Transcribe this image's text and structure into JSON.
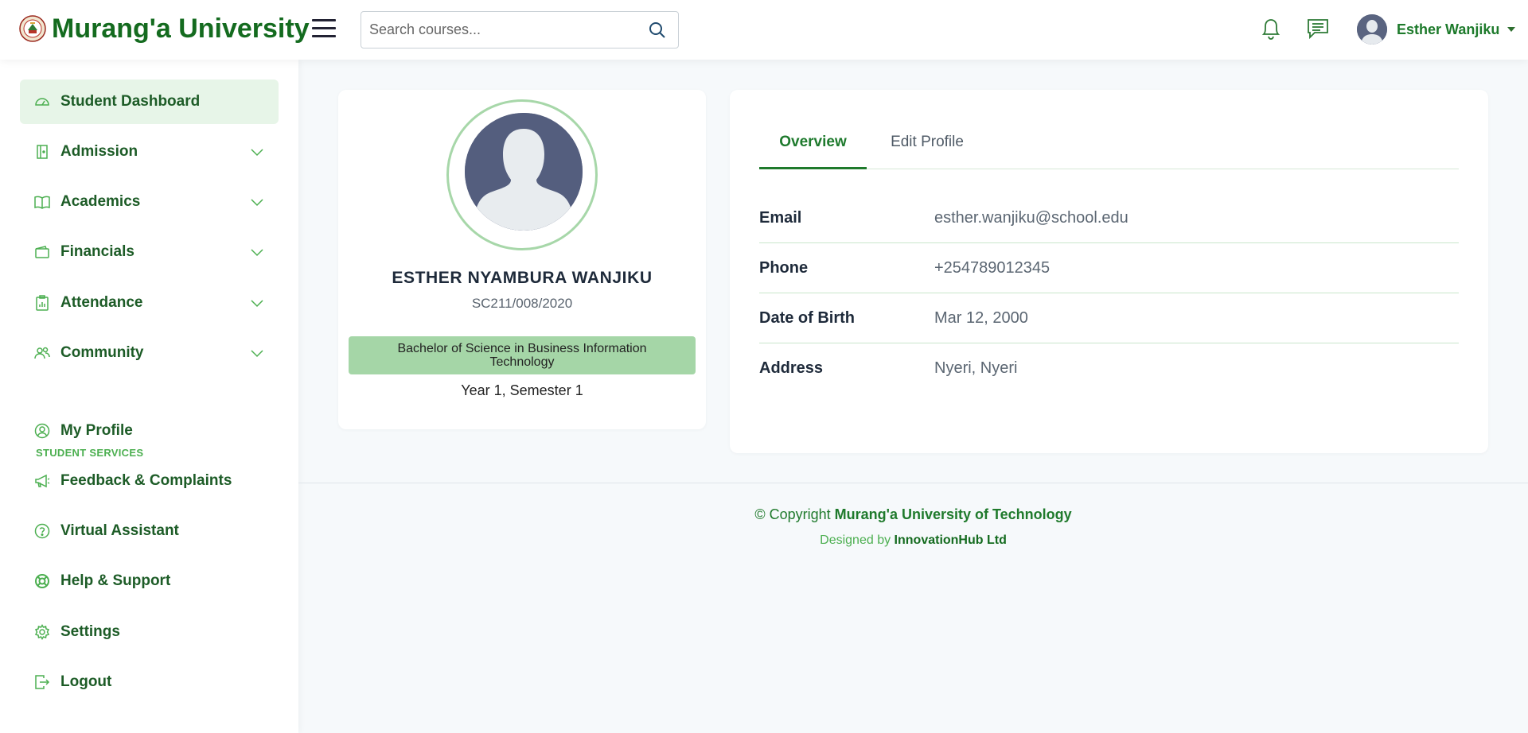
{
  "header": {
    "brand": "Murang'a University",
    "search_placeholder": "Search courses...",
    "user_name": "Esther Wanjiku"
  },
  "sidebar": {
    "items": [
      {
        "label": "Student Dashboard",
        "icon": "gauge-icon"
      },
      {
        "label": "Admission",
        "icon": "door-icon"
      },
      {
        "label": "Academics",
        "icon": "book-icon"
      },
      {
        "label": "Financials",
        "icon": "wallet-icon"
      },
      {
        "label": "Attendance",
        "icon": "clipboard-icon"
      },
      {
        "label": "Community",
        "icon": "people-icon"
      }
    ],
    "section_label": "STUDENT SERVICES",
    "services": [
      {
        "label": "My Profile",
        "icon": "user-circle-icon"
      },
      {
        "label": "Feedback & Complaints",
        "icon": "megaphone-icon"
      },
      {
        "label": "Virtual Assistant",
        "icon": "question-circle-icon"
      },
      {
        "label": "Help & Support",
        "icon": "lifebuoy-icon"
      },
      {
        "label": "Settings",
        "icon": "gear-icon"
      },
      {
        "label": "Logout",
        "icon": "logout-icon"
      }
    ]
  },
  "profile": {
    "name": "ESTHER NYAMBURA WANJIKU",
    "reg_no": "SC211/008/2020",
    "program": "Bachelor of Science in Business Information Technology",
    "year_semester": "Year 1, Semester 1"
  },
  "tabs": {
    "overview": "Overview",
    "edit": "Edit Profile"
  },
  "details": [
    {
      "label": "Email",
      "value": "esther.wanjiku@school.edu"
    },
    {
      "label": "Phone",
      "value": "+254789012345"
    },
    {
      "label": "Date of Birth",
      "value": "Mar 12, 2000"
    },
    {
      "label": "Address",
      "value": "Nyeri, Nyeri"
    }
  ],
  "footer": {
    "copyright_prefix": "© Copyright",
    "copyright_org": "Murang'a University of Technology",
    "designed_prefix": "Designed by",
    "designed_org": "InnovationHub Ltd"
  },
  "colors": {
    "brand_green": "#146b1f",
    "accent_green": "#1f7a2c",
    "light_green": "#a5d6a7",
    "active_bg": "#e7f5e8"
  }
}
